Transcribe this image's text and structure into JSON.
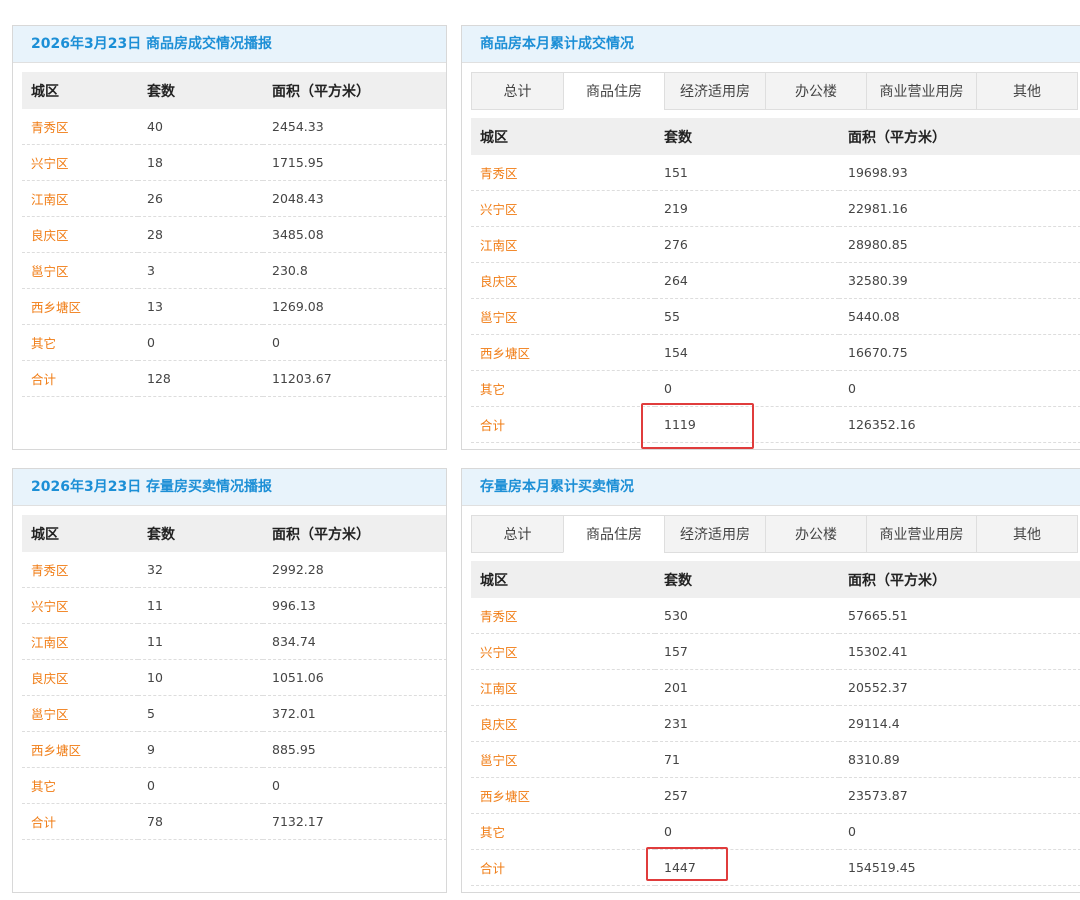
{
  "accent_color": "#1c8fd6",
  "district_color": "#f07c14",
  "highlight_color": "#e03c3c",
  "panels": {
    "daily_new": {
      "title": "2026年3月23日 商品房成交情况播报",
      "headers": [
        "城区",
        "套数",
        "面积（平方米）"
      ],
      "rows": [
        [
          "青秀区",
          "40",
          "2454.33"
        ],
        [
          "兴宁区",
          "18",
          "1715.95"
        ],
        [
          "江南区",
          "26",
          "2048.43"
        ],
        [
          "良庆区",
          "28",
          "3485.08"
        ],
        [
          "邕宁区",
          "3",
          "230.8"
        ],
        [
          "西乡塘区",
          "13",
          "1269.08"
        ],
        [
          "其它",
          "0",
          "0"
        ],
        [
          "合计",
          "128",
          "11203.67"
        ]
      ]
    },
    "monthly_new": {
      "title": "商品房本月累计成交情况",
      "tabs": [
        "总计",
        "商品住房",
        "经济适用房",
        "办公楼",
        "商业营业用房",
        "其他"
      ],
      "active_tab": "商品住房",
      "headers": [
        "城区",
        "套数",
        "面积（平方米）"
      ],
      "rows": [
        [
          "青秀区",
          "151",
          "19698.93"
        ],
        [
          "兴宁区",
          "219",
          "22981.16"
        ],
        [
          "江南区",
          "276",
          "28980.85"
        ],
        [
          "良庆区",
          "264",
          "32580.39"
        ],
        [
          "邕宁区",
          "55",
          "5440.08"
        ],
        [
          "西乡塘区",
          "154",
          "16670.75"
        ],
        [
          "其它",
          "0",
          "0"
        ],
        [
          "合计",
          "1119",
          "126352.16"
        ]
      ]
    },
    "daily_existing": {
      "title": "2026年3月23日 存量房买卖情况播报",
      "headers": [
        "城区",
        "套数",
        "面积（平方米）"
      ],
      "rows": [
        [
          "青秀区",
          "32",
          "2992.28"
        ],
        [
          "兴宁区",
          "11",
          "996.13"
        ],
        [
          "江南区",
          "11",
          "834.74"
        ],
        [
          "良庆区",
          "10",
          "1051.06"
        ],
        [
          "邕宁区",
          "5",
          "372.01"
        ],
        [
          "西乡塘区",
          "9",
          "885.95"
        ],
        [
          "其它",
          "0",
          "0"
        ],
        [
          "合计",
          "78",
          "7132.17"
        ]
      ]
    },
    "monthly_existing": {
      "title": "存量房本月累计买卖情况",
      "tabs": [
        "总计",
        "商品住房",
        "经济适用房",
        "办公楼",
        "商业营业用房",
        "其他"
      ],
      "active_tab": "商品住房",
      "headers": [
        "城区",
        "套数",
        "面积（平方米）"
      ],
      "rows": [
        [
          "青秀区",
          "530",
          "57665.51"
        ],
        [
          "兴宁区",
          "157",
          "15302.41"
        ],
        [
          "江南区",
          "201",
          "20552.37"
        ],
        [
          "良庆区",
          "231",
          "29114.4"
        ],
        [
          "邕宁区",
          "71",
          "8310.89"
        ],
        [
          "西乡塘区",
          "257",
          "23573.87"
        ],
        [
          "其它",
          "0",
          "0"
        ],
        [
          "合计",
          "1447",
          "154519.45"
        ]
      ]
    }
  }
}
